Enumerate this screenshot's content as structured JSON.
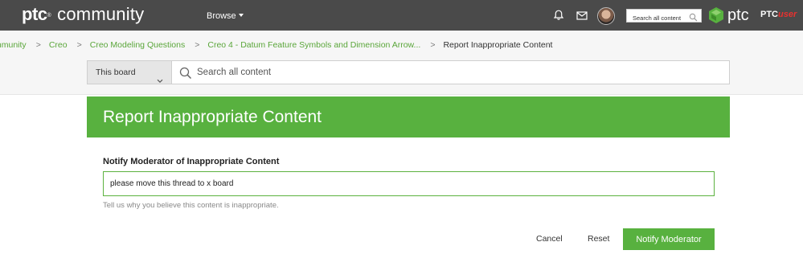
{
  "colors": {
    "topbar": "#4a4a4a",
    "brand_green": "#58b13f",
    "link_green": "#5aa63a",
    "ptc_red": "#e8312f"
  },
  "topbar": {
    "logo_ptc": "ptc",
    "logo_community": "community",
    "browse_label": "Browse",
    "search_placeholder": "Search all content",
    "icons": [
      "bell-icon",
      "mail-icon",
      "avatar",
      "search-icon",
      "ptc-logo-icon"
    ],
    "ptc_word": "ptc",
    "ptcuser_prefix": "PTC",
    "ptcuser_suffix": "user"
  },
  "breadcrumb": {
    "items": [
      "mmunity",
      "Creo",
      "Creo Modeling Questions",
      "Creo 4 - Datum Feature Symbols and Dimension Arrow..."
    ],
    "current": "Report Inappropriate Content",
    "separator": ">"
  },
  "search": {
    "scope_selected": "This board",
    "placeholder": "Search all content"
  },
  "page": {
    "title": "Report Inappropriate Content",
    "field_label": "Notify Moderator of Inappropriate Content",
    "field_value": "please move this thread to x board",
    "help_text": "Tell us why you believe this content is inappropriate."
  },
  "actions": {
    "cancel": "Cancel",
    "reset": "Reset",
    "submit": "Notify Moderator"
  }
}
